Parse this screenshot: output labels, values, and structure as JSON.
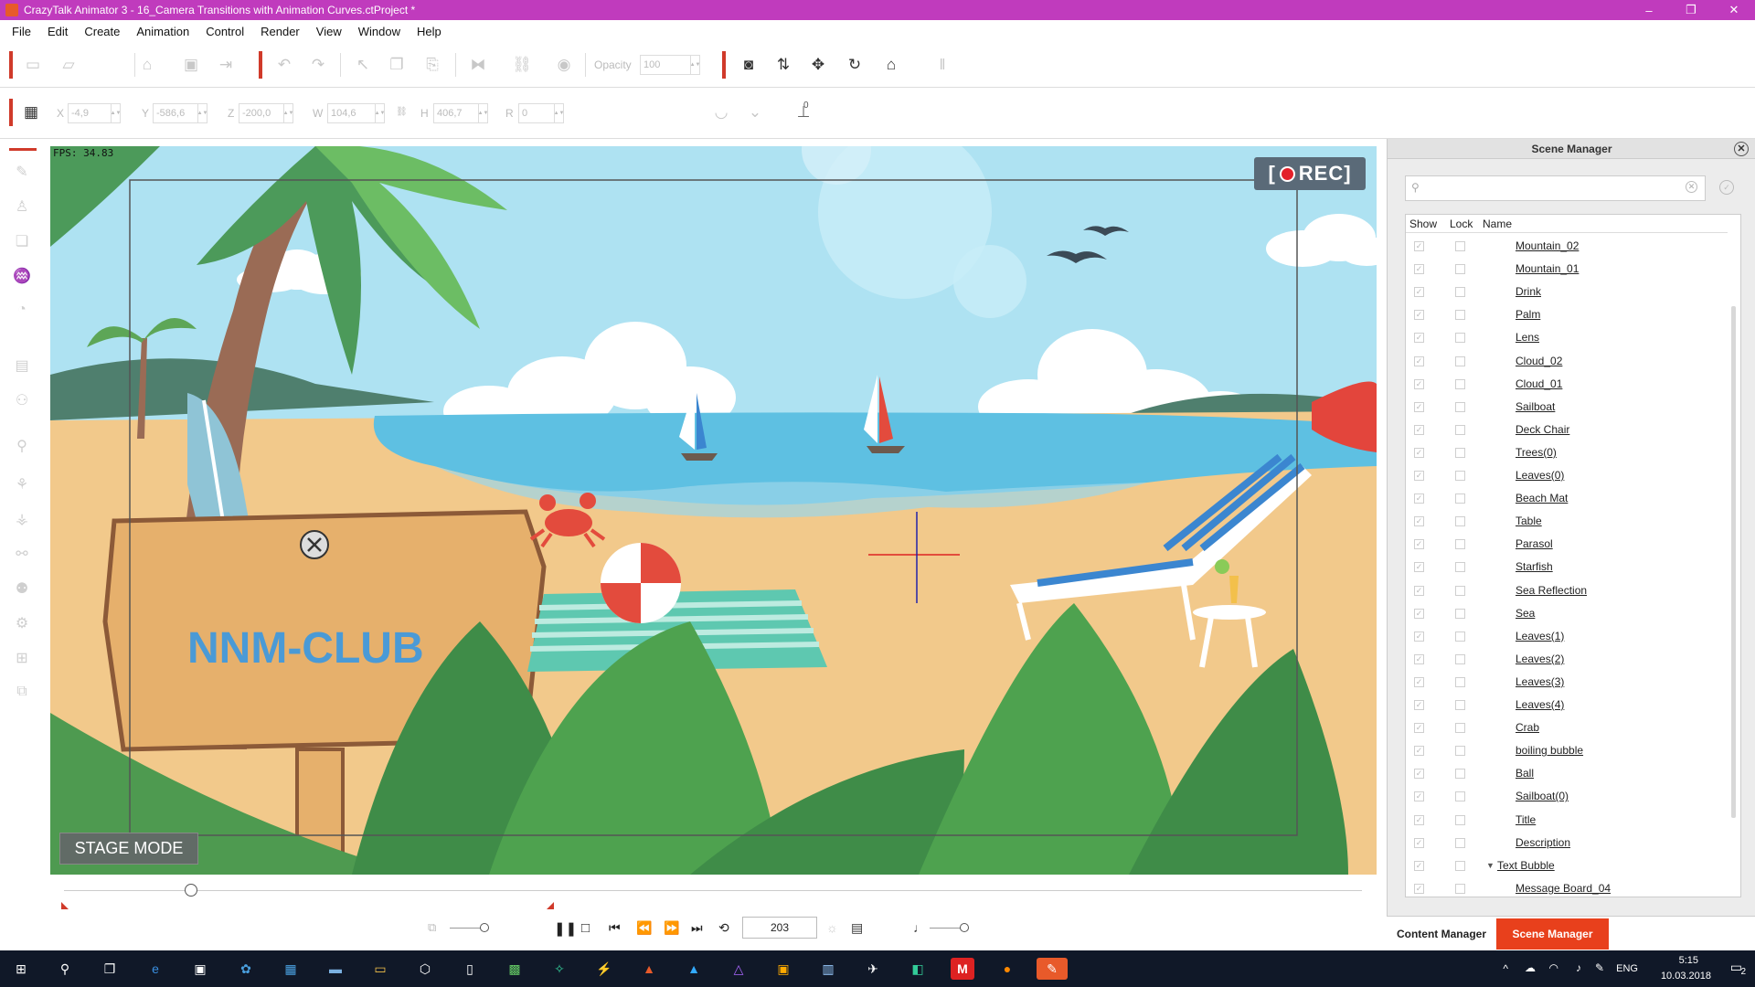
{
  "window": {
    "title": "CrazyTalk Animator 3 - 16_Camera Transitions with Animation Curves.ctProject *",
    "controls": [
      "–",
      "❐",
      "✕"
    ]
  },
  "menu": [
    "File",
    "Edit",
    "Create",
    "Animation",
    "Control",
    "Render",
    "View",
    "Window",
    "Help"
  ],
  "toolbar": {
    "opacity_label": "Opacity",
    "opacity_value": "100"
  },
  "transform": {
    "x_label": "X",
    "x_value": "-4,9",
    "y_label": "Y",
    "y_value": "-586,6",
    "z_label": "Z",
    "z_value": "-200,0",
    "w_label": "W",
    "w_value": "104,6",
    "h_label": "H",
    "h_value": "406,7",
    "r_label": "R",
    "r_value": "0",
    "angle_value": "0"
  },
  "stage": {
    "fps": "FPS: 34.83",
    "rec_label": "REC",
    "sign_text": "NNM-CLUB",
    "stage_mode_label": "STAGE MODE"
  },
  "playback": {
    "frame": "203"
  },
  "scene_manager": {
    "title": "Scene Manager",
    "search_placeholder": "",
    "columns": {
      "show": "Show",
      "lock": "Lock",
      "name": "Name"
    },
    "items": [
      {
        "name": "Mountain_02",
        "indent": 1
      },
      {
        "name": "Mountain_01",
        "indent": 1
      },
      {
        "name": "Drink",
        "indent": 1
      },
      {
        "name": "Palm",
        "indent": 1
      },
      {
        "name": "Lens",
        "indent": 1
      },
      {
        "name": "Cloud_02",
        "indent": 1
      },
      {
        "name": "Cloud_01",
        "indent": 1
      },
      {
        "name": "Sailboat",
        "indent": 1
      },
      {
        "name": "Deck Chair",
        "indent": 1
      },
      {
        "name": "Trees(0)",
        "indent": 1
      },
      {
        "name": "Leaves(0)",
        "indent": 1
      },
      {
        "name": "Beach Mat",
        "indent": 1
      },
      {
        "name": "Table",
        "indent": 1
      },
      {
        "name": "Parasol",
        "indent": 1
      },
      {
        "name": "Starfish",
        "indent": 1
      },
      {
        "name": "Sea Reflection",
        "indent": 1
      },
      {
        "name": "Sea",
        "indent": 1
      },
      {
        "name": "Leaves(1)",
        "indent": 1
      },
      {
        "name": "Leaves(2)",
        "indent": 1
      },
      {
        "name": "Leaves(3)",
        "indent": 1
      },
      {
        "name": "Leaves(4)",
        "indent": 1
      },
      {
        "name": "Crab",
        "indent": 1
      },
      {
        "name": "boiling bubble",
        "indent": 1
      },
      {
        "name": "Ball",
        "indent": 1
      },
      {
        "name": "Sailboat(0)",
        "indent": 1
      },
      {
        "name": "Title",
        "indent": 1
      },
      {
        "name": "Description",
        "indent": 1
      },
      {
        "name": "Text Bubble",
        "indent": 0,
        "expanded": true
      },
      {
        "name": "Message Board_04",
        "indent": 1
      }
    ]
  },
  "bottom_tabs": {
    "content_manager": "Content Manager",
    "scene_manager": "Scene Manager",
    "active_color": "#e8401c"
  },
  "taskbar": {
    "lang": "ENG",
    "time": "5:15",
    "date": "10.03.2018",
    "notifications": "2"
  }
}
